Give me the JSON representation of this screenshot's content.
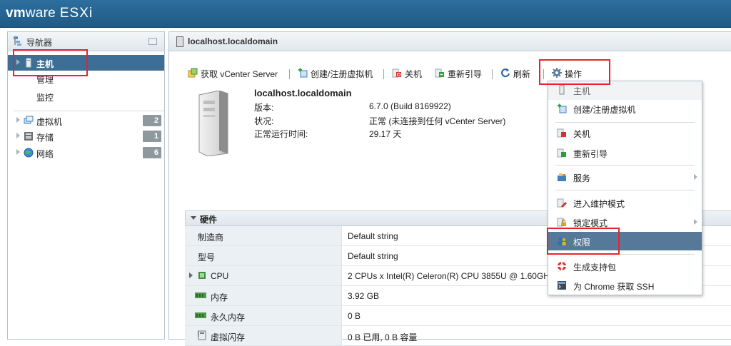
{
  "brand": {
    "vm": "vm",
    "ware": "ware",
    "product": "ESXi"
  },
  "navigator": {
    "title": "导航器",
    "items": [
      {
        "label": "主机"
      },
      {
        "label": "管理"
      },
      {
        "label": "监控"
      },
      {
        "label": "虚拟机",
        "count": "2"
      },
      {
        "label": "存储",
        "count": "1"
      },
      {
        "label": "网络",
        "count": "6"
      }
    ]
  },
  "main": {
    "title": "localhost.localdomain",
    "toolbar": {
      "vcenter": "获取 vCenter Server",
      "create_vm": "创建/注册虚拟机",
      "shutdown": "关机",
      "reboot": "重新引导",
      "refresh": "刷新",
      "actions": "操作"
    },
    "host": {
      "name": "localhost.localdomain",
      "version_label": "版本:",
      "version_value": "6.7.0 (Build 8169922)",
      "status_label": "状况:",
      "status_value": "正常 (未连接到任何 vCenter Server)",
      "uptime_label": "正常运行时间:",
      "uptime_value": "29.17 天"
    },
    "hardware": {
      "title": "硬件",
      "rows": [
        {
          "key": "制造商",
          "value": "Default string"
        },
        {
          "key": "型号",
          "value": "Default string"
        },
        {
          "key": "CPU",
          "value": "2 CPUs x Intel(R) Celeron(R) CPU 3855U @ 1.60GHz"
        },
        {
          "key": "内存",
          "value": "3.92 GB"
        },
        {
          "key": "永久内存",
          "value": "0 B"
        },
        {
          "key": "虚拟闪存",
          "value": "0 B 已用, 0 B 容量"
        }
      ]
    }
  },
  "menu": {
    "header": "主机",
    "items": [
      {
        "label": "创建/注册虚拟机"
      },
      {
        "label": "关机"
      },
      {
        "label": "重新引导"
      },
      {
        "label": "服务"
      },
      {
        "label": "进入维护模式"
      },
      {
        "label": "锁定模式"
      },
      {
        "label": "权限"
      },
      {
        "label": "生成支持包"
      },
      {
        "label": "为 Chrome 获取 SSH"
      }
    ]
  },
  "colors": {
    "accent": "#3d6e95",
    "annotation": "#e8232f",
    "banner": "#2d6f9e"
  }
}
